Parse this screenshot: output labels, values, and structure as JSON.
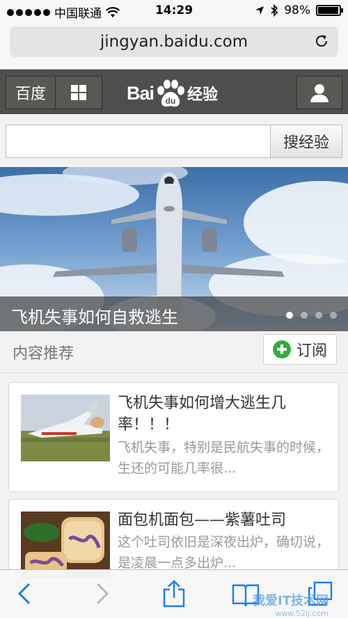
{
  "status_bar": {
    "carrier": "中国联通",
    "time": "14:29",
    "battery_percent": "98%",
    "battery_level": 0.98
  },
  "browser": {
    "url": "jingyan.baidu.com"
  },
  "header": {
    "baidu_button": "百度",
    "logo_text_bai": "Bai",
    "logo_text_du": "du",
    "logo_text_jingyan": "经验"
  },
  "search": {
    "input_value": "",
    "button_label": "搜经验"
  },
  "banner": {
    "caption": "飞机失事如何自救逃生",
    "slide_count": 4,
    "active_slide": 1
  },
  "section": {
    "title": "内容推荐",
    "subscribe_label": "订阅"
  },
  "articles": [
    {
      "title": "飞机失事如何增大逃生几率！！！",
      "desc": "飞机失事，特别是民航失事的时候，生还的可能几率很..."
    },
    {
      "title": "面包机面包——紫薯吐司",
      "desc": "这个吐司依旧是深夜出炉，确切说，是凌晨一点多出炉..."
    }
  ],
  "watermark": {
    "main": "我爱IT技术网",
    "sub": "www.52ij.com"
  },
  "icons": {
    "wifi": "wifi-icon",
    "location": "location-arrow-icon",
    "bluetooth": "bluetooth-icon",
    "reload": "reload-icon",
    "grid": "grid-icon",
    "user": "user-icon",
    "back": "back-icon",
    "forward": "forward-icon",
    "share": "share-icon",
    "bookmarks": "bookmarks-icon",
    "tabs": "tabs-icon"
  },
  "colors": {
    "header_bg": "#4d4f4c",
    "subscribe_green": "#2eaf3a",
    "ios_blue": "#1a7cf4"
  }
}
